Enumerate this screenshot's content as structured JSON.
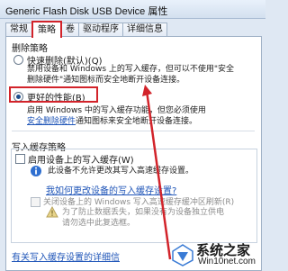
{
  "window": {
    "title": "Generic Flash Disk USB Device 属性"
  },
  "tabs": [
    {
      "label": "常规"
    },
    {
      "label": "策略"
    },
    {
      "label": "卷"
    },
    {
      "label": "驱动程序"
    },
    {
      "label": "详细信息"
    }
  ],
  "removal_policy": {
    "group_title": "删除策略",
    "quick_removal": {
      "label": "快速删除(默认)(Q)",
      "desc_line1": "禁用设备和 Windows 上的写入缓存，但可以不使用\"安全",
      "desc_line2": "删除硬件\"通知图标而安全地断开设备连接。"
    },
    "better_performance": {
      "label": "更好的性能(B)",
      "desc_line1": "启用 Windows 中的写入缓存功能，但您必须使用",
      "desc_link": "安全删除硬件",
      "desc_line2_rest": "通知图标来安全地断开设备连接。"
    }
  },
  "write_cache_policy": {
    "group_title": "写入缓存策略",
    "enable_cache": {
      "label": "启用设备上的写入缓存(W)",
      "desc": "此设备不允许更改其写入高速缓存设置。"
    },
    "change_settings_link": "我如何更改设备的写入缓存设置?",
    "disable_flush": {
      "label": "关闭设备上的 Windows 写入高速缓存缓冲区刷新(R)",
      "desc_line1": "为了防止数据丢失，如果没有为设备独立供电",
      "desc_line2": "请勿选中此复选框。"
    }
  },
  "footer_link": "有关写入缓存设置的详细信",
  "watermark": {
    "brand": "系统之家",
    "url": "Win10net.com"
  },
  "colors": {
    "highlight": "#d2232a",
    "link": "#1f55b8",
    "window_bg": "#dfe8f3"
  }
}
